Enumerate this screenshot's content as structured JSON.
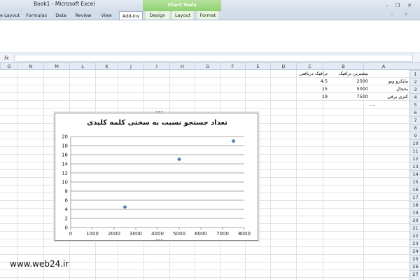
{
  "window": {
    "title": "Book1 - Microsoft Excel",
    "context_group": "Chart Tools"
  },
  "ribbon_tabs": [
    {
      "label": "e Layout",
      "left": 0,
      "width": 28
    },
    {
      "label": "Formulas",
      "left": 33,
      "width": 38
    },
    {
      "label": "Data",
      "left": 76,
      "width": 22
    },
    {
      "label": "Review",
      "left": 104,
      "width": 30
    },
    {
      "label": "View",
      "left": 140,
      "width": 24
    },
    {
      "label": "Add-Ins",
      "left": 170,
      "width": 34,
      "active": true
    },
    {
      "label": "Design",
      "left": 208,
      "width": 34,
      "context": true
    },
    {
      "label": "Layout",
      "left": 246,
      "width": 30,
      "context": true
    },
    {
      "label": "Format",
      "left": 282,
      "width": 30,
      "context": true
    }
  ],
  "formula_bar": {
    "fx_label": "fx",
    "value": ""
  },
  "column_headers": [
    "O",
    "N",
    "M",
    "L",
    "K",
    "J",
    "I",
    "H",
    "G",
    "F",
    "E",
    "D",
    "C",
    "B",
    "A"
  ],
  "row_headers": [
    "1",
    "2",
    "3",
    "4",
    "5",
    "6",
    "7",
    "8",
    "9",
    "10",
    "11",
    "12",
    "13",
    "14",
    "15",
    "16",
    "17",
    "18",
    "19",
    "20",
    "21",
    "22",
    "23",
    "24",
    "25",
    "26",
    "27"
  ],
  "sheet": {
    "header_c": "ترافیک دریافتی",
    "header_b": "بیشترین ترافیک",
    "rows": [
      {
        "a": "مایکرو ویو",
        "b": "2500",
        "c": "4.5"
      },
      {
        "a": "یخچال",
        "b": "5000",
        "c": "15"
      },
      {
        "a": "کتری برقی",
        "b": "7500",
        "c": "19"
      }
    ],
    "ellipsis": "...."
  },
  "chart_data": {
    "type": "scatter",
    "title": "تعداد جستجو نسبت به سختی کلمه کلیدی",
    "x": [
      2500,
      5000,
      7500
    ],
    "y": [
      4.5,
      15,
      19
    ],
    "xlim": [
      0,
      8000
    ],
    "ylim": [
      0,
      20
    ],
    "xticks": [
      0,
      1000,
      2000,
      3000,
      4000,
      5000,
      6000,
      7000,
      8000
    ],
    "yticks": [
      0,
      2,
      4,
      6,
      8,
      10,
      12,
      14,
      16,
      18,
      20
    ],
    "grid": true,
    "legend": "none",
    "marker_color": "#4a7ebb"
  },
  "watermark": "www.web24.ir"
}
